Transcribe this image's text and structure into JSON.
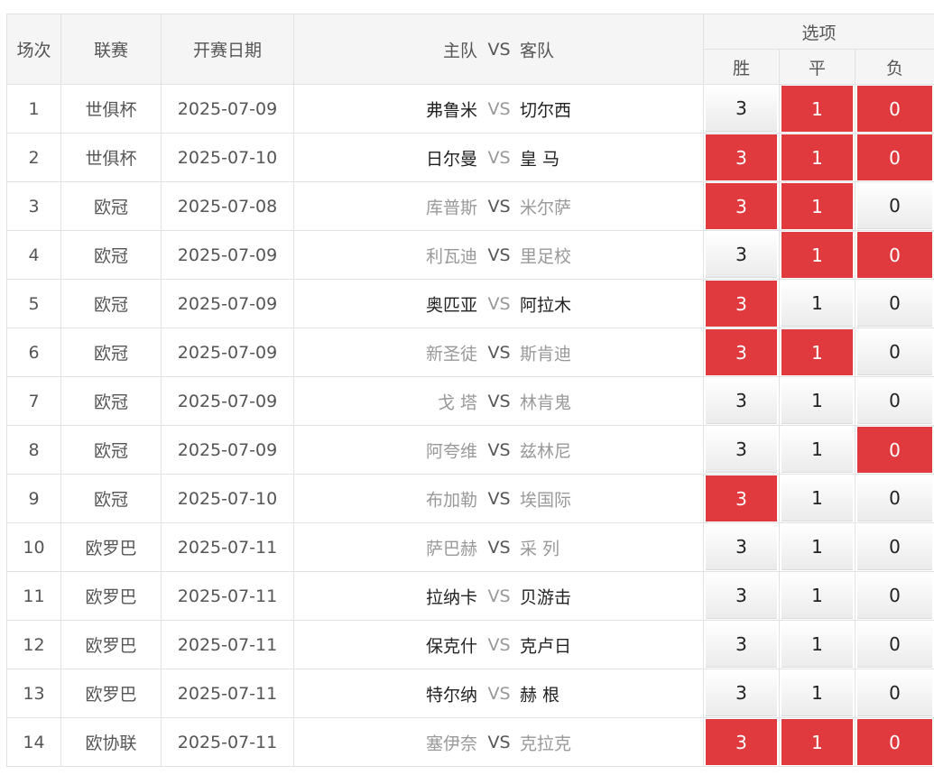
{
  "header": {
    "col_index": "场次",
    "col_league": "联赛",
    "col_date": "开赛日期",
    "col_home": "主队",
    "col_vs": "VS",
    "col_away": "客队",
    "col_options": "选项",
    "opt_win": "胜",
    "opt_draw": "平",
    "opt_loss": "负"
  },
  "colors": {
    "selected": "#e03a3e",
    "team_dark": "#222222",
    "team_grey": "#999999"
  },
  "rows": [
    {
      "index": "1",
      "league": "世俱杯",
      "date": "2025-07-09",
      "home": "弗鲁米",
      "vs": "VS",
      "away": "切尔西",
      "home_style": "dark",
      "away_style": "dark",
      "vs_style": "grey",
      "win": "3",
      "draw": "1",
      "loss": "0",
      "win_sel": false,
      "draw_sel": true,
      "loss_sel": true
    },
    {
      "index": "2",
      "league": "世俱杯",
      "date": "2025-07-10",
      "home": "日尔曼",
      "vs": "VS",
      "away": "皇 马",
      "home_style": "dark",
      "away_style": "dark",
      "vs_style": "grey",
      "win": "3",
      "draw": "1",
      "loss": "0",
      "win_sel": true,
      "draw_sel": true,
      "loss_sel": true
    },
    {
      "index": "3",
      "league": "欧冠",
      "date": "2025-07-08",
      "home": "库普斯",
      "vs": "VS",
      "away": "米尔萨",
      "home_style": "grey",
      "away_style": "grey",
      "vs_style": "dark",
      "win": "3",
      "draw": "1",
      "loss": "0",
      "win_sel": true,
      "draw_sel": true,
      "loss_sel": false
    },
    {
      "index": "4",
      "league": "欧冠",
      "date": "2025-07-09",
      "home": "利瓦迪",
      "vs": "VS",
      "away": "里足校",
      "home_style": "grey",
      "away_style": "grey",
      "vs_style": "dark",
      "win": "3",
      "draw": "1",
      "loss": "0",
      "win_sel": false,
      "draw_sel": true,
      "loss_sel": true
    },
    {
      "index": "5",
      "league": "欧冠",
      "date": "2025-07-09",
      "home": "奥匹亚",
      "vs": "VS",
      "away": "阿拉木",
      "home_style": "dark",
      "away_style": "dark",
      "vs_style": "grey",
      "win": "3",
      "draw": "1",
      "loss": "0",
      "win_sel": true,
      "draw_sel": false,
      "loss_sel": false
    },
    {
      "index": "6",
      "league": "欧冠",
      "date": "2025-07-09",
      "home": "新圣徒",
      "vs": "VS",
      "away": "斯肯迪",
      "home_style": "grey",
      "away_style": "grey",
      "vs_style": "dark",
      "win": "3",
      "draw": "1",
      "loss": "0",
      "win_sel": true,
      "draw_sel": true,
      "loss_sel": false
    },
    {
      "index": "7",
      "league": "欧冠",
      "date": "2025-07-09",
      "home": "戈 塔",
      "vs": "VS",
      "away": "林肯鬼",
      "home_style": "grey",
      "away_style": "grey",
      "vs_style": "dark",
      "win": "3",
      "draw": "1",
      "loss": "0",
      "win_sel": false,
      "draw_sel": false,
      "loss_sel": false
    },
    {
      "index": "8",
      "league": "欧冠",
      "date": "2025-07-09",
      "home": "阿夸维",
      "vs": "VS",
      "away": "兹林尼",
      "home_style": "grey",
      "away_style": "grey",
      "vs_style": "dark",
      "win": "3",
      "draw": "1",
      "loss": "0",
      "win_sel": false,
      "draw_sel": false,
      "loss_sel": true
    },
    {
      "index": "9",
      "league": "欧冠",
      "date": "2025-07-10",
      "home": "布加勒",
      "vs": "VS",
      "away": "埃国际",
      "home_style": "grey",
      "away_style": "grey",
      "vs_style": "dark",
      "win": "3",
      "draw": "1",
      "loss": "0",
      "win_sel": true,
      "draw_sel": false,
      "loss_sel": false
    },
    {
      "index": "10",
      "league": "欧罗巴",
      "date": "2025-07-11",
      "home": "萨巴赫",
      "vs": "VS",
      "away": "采 列",
      "home_style": "grey",
      "away_style": "grey",
      "vs_style": "dark",
      "win": "3",
      "draw": "1",
      "loss": "0",
      "win_sel": false,
      "draw_sel": false,
      "loss_sel": false
    },
    {
      "index": "11",
      "league": "欧罗巴",
      "date": "2025-07-11",
      "home": "拉纳卡",
      "vs": "VS",
      "away": "贝游击",
      "home_style": "dark",
      "away_style": "dark",
      "vs_style": "grey",
      "win": "3",
      "draw": "1",
      "loss": "0",
      "win_sel": false,
      "draw_sel": false,
      "loss_sel": false
    },
    {
      "index": "12",
      "league": "欧罗巴",
      "date": "2025-07-11",
      "home": "保克什",
      "vs": "VS",
      "away": "克卢日",
      "home_style": "dark",
      "away_style": "dark",
      "vs_style": "grey",
      "win": "3",
      "draw": "1",
      "loss": "0",
      "win_sel": false,
      "draw_sel": false,
      "loss_sel": false
    },
    {
      "index": "13",
      "league": "欧罗巴",
      "date": "2025-07-11",
      "home": "特尔纳",
      "vs": "VS",
      "away": "赫 根",
      "home_style": "dark",
      "away_style": "dark",
      "vs_style": "grey",
      "win": "3",
      "draw": "1",
      "loss": "0",
      "win_sel": false,
      "draw_sel": false,
      "loss_sel": false
    },
    {
      "index": "14",
      "league": "欧协联",
      "date": "2025-07-11",
      "home": "塞伊奈",
      "vs": "VS",
      "away": "克拉克",
      "home_style": "grey",
      "away_style": "grey",
      "vs_style": "dark",
      "win": "3",
      "draw": "1",
      "loss": "0",
      "win_sel": true,
      "draw_sel": true,
      "loss_sel": true
    }
  ]
}
